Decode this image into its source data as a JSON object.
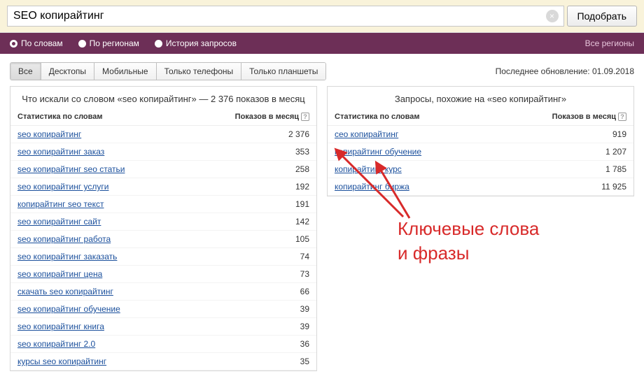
{
  "search": {
    "value": "SEO копирайтинг",
    "submit": "Подобрать"
  },
  "filters": {
    "words": "По словам",
    "regions": "По регионам",
    "history": "История запросов",
    "all_regions": "Все регионы"
  },
  "tabs": {
    "all": "Все",
    "desktops": "Десктопы",
    "mobile": "Мобильные",
    "phones": "Только телефоны",
    "tablets": "Только планшеты"
  },
  "last_update": "Последнее обновление: 01.09.2018",
  "left_panel": {
    "title": "Что искали со словом «seo копирайтинг» — 2 376 показов в месяц",
    "col1": "Статистика по словам",
    "col2": "Показов в месяц",
    "rows": [
      {
        "q": "seo копирайтинг",
        "n": "2 376"
      },
      {
        "q": "seo копирайтинг заказ",
        "n": "353"
      },
      {
        "q": "seo копирайтинг seo статьи",
        "n": "258"
      },
      {
        "q": "seo копирайтинг услуги",
        "n": "192"
      },
      {
        "q": "копирайтинг seo текст",
        "n": "191"
      },
      {
        "q": "seo копирайтинг сайт",
        "n": "142"
      },
      {
        "q": "seo копирайтинг работа",
        "n": "105"
      },
      {
        "q": "seo копирайтинг заказать",
        "n": "74"
      },
      {
        "q": "seo копирайтинг цена",
        "n": "73"
      },
      {
        "q": "скачать seo копирайтинг",
        "n": "66"
      },
      {
        "q": "seo копирайтинг обучение",
        "n": "39"
      },
      {
        "q": "seo копирайтинг книга",
        "n": "39"
      },
      {
        "q": "seo копирайтинг 2.0",
        "n": "36"
      },
      {
        "q": "курсы seo копирайтинг",
        "n": "35"
      }
    ]
  },
  "right_panel": {
    "title": "Запросы, похожие на «seo копирайтинг»",
    "col1": "Статистика по словам",
    "col2": "Показов в месяц",
    "rows": [
      {
        "q": "сео копирайтинг",
        "n": "919"
      },
      {
        "q": "копирайтинг обучение",
        "n": "1 207"
      },
      {
        "q": "копирайтинг курс",
        "n": "1 785"
      },
      {
        "q": "копирайтинг биржа",
        "n": "11 925"
      }
    ]
  },
  "annotation": {
    "line1": "Ключевые слова",
    "line2": "и фразы"
  }
}
